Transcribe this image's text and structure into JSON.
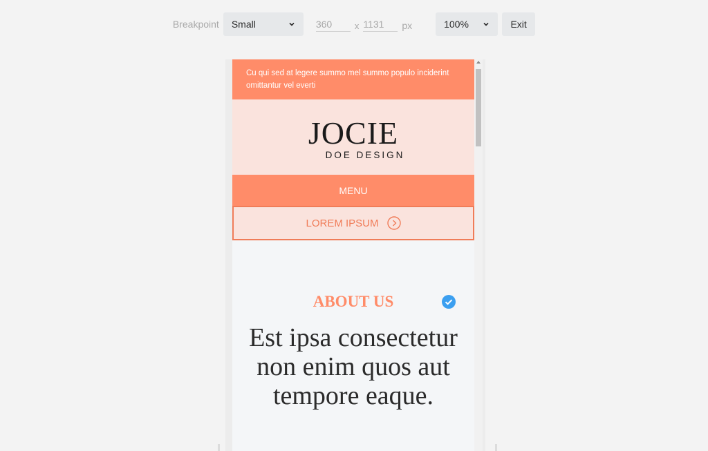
{
  "toolbar": {
    "breakpoint_label": "Breakpoint",
    "breakpoint_value": "Small",
    "width_value": "360",
    "height_value": "1131",
    "separator": "x",
    "unit": "px",
    "zoom_value": "100%",
    "exit_label": "Exit"
  },
  "preview": {
    "topbar_text": "Cu qui sed at legere summo mel summo populo inciderint omittantur vel everti",
    "logo_main": "JOCIE",
    "logo_sub": "DOE DESIGN",
    "menu_label": "MENU",
    "cta_label": "LOREM IPSUM",
    "about_title": "ABOUT US",
    "headline": "Est ipsa consectetur non enim quos aut tempore eaque."
  },
  "colors": {
    "accent": "#ff8c69",
    "accent_dark": "#f07c58",
    "blush": "#fae3dd",
    "check_blue": "#3b9ff0"
  },
  "icons": {
    "select_arrow": "chevron-down-icon",
    "cta_arrow": "chevron-right-circle-icon",
    "about_check": "check-circle-icon"
  }
}
